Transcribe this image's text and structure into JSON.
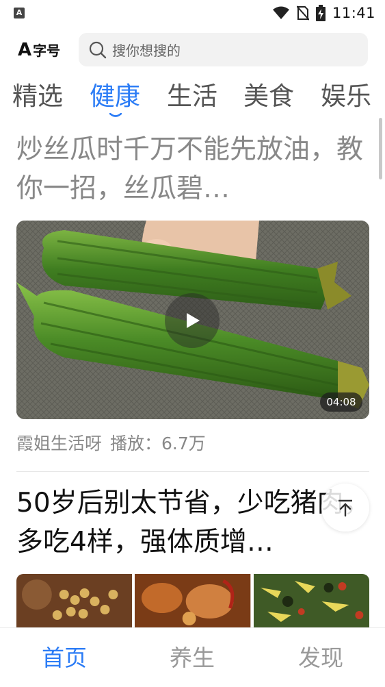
{
  "status_bar": {
    "app_badge": "A",
    "time": "11:41",
    "icons": [
      "wifi-icon",
      "no-sim-icon",
      "battery-charging-icon"
    ]
  },
  "header": {
    "font_size_label": "字号",
    "font_size_glyph": "A",
    "search_placeholder": "搜你想搜的"
  },
  "tabs": [
    {
      "label": "精选",
      "active": false
    },
    {
      "label": "健康",
      "active": true
    },
    {
      "label": "生活",
      "active": false
    },
    {
      "label": "美食",
      "active": false
    },
    {
      "label": "娱乐",
      "active": false
    }
  ],
  "feed": [
    {
      "title": "炒丝瓜时千万不能先放油，教你一招，丝瓜碧…",
      "type": "video",
      "duration": "04:08",
      "author": "霞姐生活呀",
      "plays": "播放：6.7万"
    },
    {
      "title": "50岁后别太节省，少吃猪肉，多吃4样，强体质增…",
      "type": "images"
    }
  ],
  "bottom_nav": [
    {
      "label": "首页",
      "active": true
    },
    {
      "label": "养生",
      "active": false
    },
    {
      "label": "发现",
      "active": false
    }
  ],
  "colors": {
    "accent": "#2b7cf6",
    "inactive_tab": "#555555",
    "muted_text": "#888888"
  }
}
